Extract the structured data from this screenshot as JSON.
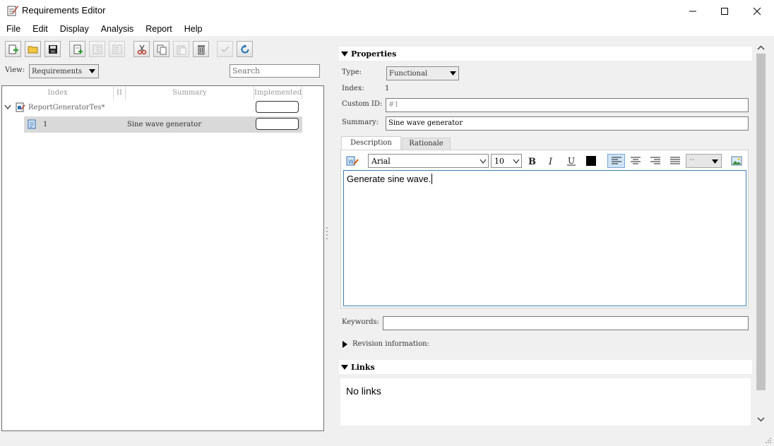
{
  "window": {
    "title": "Requirements Editor"
  },
  "menu": [
    "File",
    "Edit",
    "Display",
    "Analysis",
    "Report",
    "Help"
  ],
  "toolbar": {
    "icons": [
      "add-requirement-icon",
      "open-folder-icon",
      "save-icon",
      "add-child-icon",
      "demote-icon",
      "promote-icon",
      "cut-icon",
      "copy-icon",
      "paste-icon",
      "delete-icon",
      "justify-icon",
      "refresh-icon"
    ]
  },
  "view": {
    "label": "View:",
    "selected": "Requirements"
  },
  "search": {
    "placeholder": "Search"
  },
  "tree": {
    "columns": {
      "index": "Index",
      "id": "II",
      "summary": "Summary",
      "implemented": "Implemented"
    },
    "root": {
      "label": "ReportGeneratorTes*"
    },
    "rows": [
      {
        "index": "1",
        "summary": "Sine wave generator"
      }
    ]
  },
  "properties": {
    "header": "Properties",
    "type_label": "Type:",
    "type_value": "Functional",
    "index_label": "Index:",
    "index_value": "1",
    "custom_id_label": "Custom ID:",
    "custom_id_value": "#1",
    "summary_label": "Summary:",
    "summary_value": "Sine wave generator",
    "tabs": [
      "Description",
      "Rationale"
    ],
    "font": "Arial",
    "font_size": "10",
    "style_dropdown": "--",
    "description_text": "Generate sine wave.",
    "keywords_label": "Keywords:",
    "keywords_value": "",
    "revision_label": "Revision information:"
  },
  "links": {
    "header": "Links",
    "empty_text": "No links"
  },
  "colors": {
    "accent": "#3c7fb1",
    "selected_row": "#d9d9d9",
    "panel_border": "#6f6f6f"
  }
}
